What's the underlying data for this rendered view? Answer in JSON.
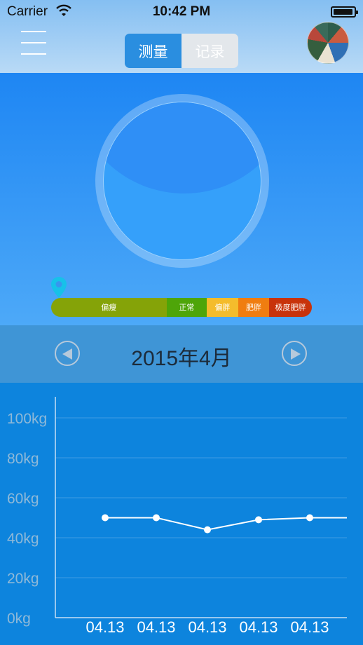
{
  "status_bar": {
    "carrier": "Carrier",
    "time": "10:42 PM"
  },
  "header": {
    "tabs": [
      {
        "label": "测量",
        "active": true
      },
      {
        "label": "记录",
        "active": false
      }
    ],
    "menu_icon": "hamburger-menu-icon",
    "avatar_icon": "user-avatar"
  },
  "bmi_scale": {
    "segments": [
      {
        "label": "偏瘦",
        "color": "#85a308"
      },
      {
        "label": "正常",
        "color": "#4ea509"
      },
      {
        "label": "偏胖",
        "color": "#f4bc2c"
      },
      {
        "label": "肥胖",
        "color": "#f07d10"
      },
      {
        "label": "极度肥胖",
        "color": "#c8330b"
      }
    ],
    "pin_icon": "location-pin-icon"
  },
  "month_nav": {
    "label": "2015年4月",
    "prev_icon": "chevron-left-icon",
    "next_icon": "chevron-right-icon"
  },
  "chart_data": {
    "type": "line",
    "y_ticks": [
      "0kg",
      "20kg",
      "40kg",
      "60kg",
      "80kg",
      "100kg"
    ],
    "ylim": [
      0,
      105
    ],
    "categories": [
      "04.13",
      "04.13",
      "04.13",
      "04.13",
      "04.13"
    ],
    "values": [
      50,
      50,
      44,
      49,
      50
    ],
    "grid": true
  }
}
